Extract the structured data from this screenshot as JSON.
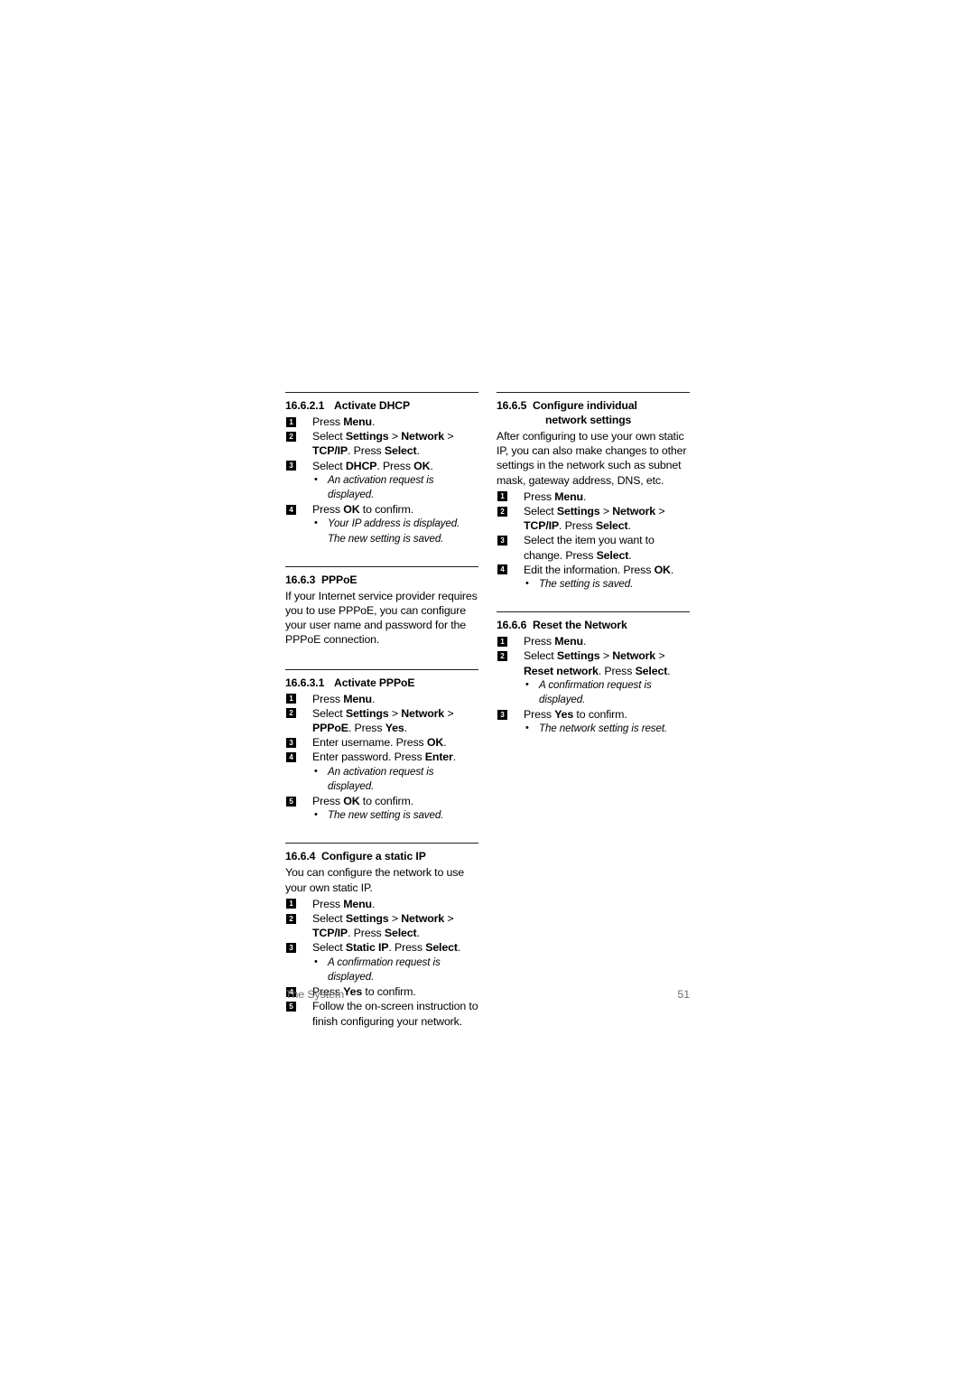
{
  "page": {
    "footer_left": "The System",
    "footer_page_number": "51",
    "footer_color": "#6d6e71",
    "rule_color": "#231f20",
    "background": "#ffffff"
  },
  "left_column": {
    "section_16_6_2_1": {
      "number": "16.6.2.1",
      "title": "Activate DHCP",
      "steps": [
        {
          "badge": "1",
          "text_html": "Press <b>Menu</b>."
        },
        {
          "badge": "2",
          "text_html": "Select <b>Settings</b> &gt; <b>Network</b> &gt; <b>TCP/IP</b>. Press <b>Select</b>."
        },
        {
          "badge": "3",
          "text_html": "Select <b>DHCP</b>. Press <b>OK</b>."
        }
      ],
      "note_after_step3": "An activation request is displayed.",
      "step4": {
        "badge": "4",
        "text_html": "Press <b>OK</b> to confirm."
      },
      "note_after_step4": "Your IP address is displayed. The new setting is saved."
    },
    "section_16_6_3": {
      "number": "16.6.3",
      "title": "PPPoE",
      "body": "If your Internet service provider requires you to use PPPoE, you can configure your user name and password for the PPPoE connection."
    },
    "section_16_6_3_1": {
      "number": "16.6.3.1",
      "title": "Activate PPPoE",
      "steps": [
        {
          "badge": "1",
          "text_html": "Press <b>Menu</b>."
        },
        {
          "badge": "2",
          "text_html": "Select <b>Settings</b> &gt; <b>Network</b> &gt; <b>PPPoE</b>. Press <b>Yes</b>."
        },
        {
          "badge": "3",
          "text_html": "Enter username. Press <b>OK</b>."
        },
        {
          "badge": "4",
          "text_html": "Enter password. Press <b>Enter</b>."
        }
      ],
      "note_after_step4": "An activation request is displayed.",
      "step5": {
        "badge": "5",
        "text_html": "Press <b>OK</b> to confirm."
      },
      "note_after_step5": "The new setting is saved."
    },
    "section_16_6_4": {
      "number": "16.6.4",
      "title": "Configure a static IP",
      "body": "You can configure the network to use your own static IP.",
      "steps": [
        {
          "badge": "1",
          "text_html": "Press <b>Menu</b>."
        },
        {
          "badge": "2",
          "text_html": "Select <b>Settings</b> &gt; <b>Network</b> &gt; <b>TCP/IP</b>. Press <b>Select</b>."
        },
        {
          "badge": "3",
          "text_html": "Select <b>Static IP</b>. Press <b>Select</b>."
        }
      ],
      "note_after_step3": "A confirmation request is displayed.",
      "step4": {
        "badge": "4",
        "text_html": "Press <b>Yes</b> to confirm."
      },
      "step5": {
        "badge": "5",
        "text_html": "Follow the on-screen instruction to finish configuring your network."
      }
    }
  },
  "right_column": {
    "section_16_6_5": {
      "number": "16.6.5",
      "title_line1": "Configure individual",
      "title_line2": "network settings",
      "body": "After configuring to use your own static IP, you can also make changes to other settings in the network such as subnet mask, gateway address, DNS, etc.",
      "steps": [
        {
          "badge": "1",
          "text_html": "Press <b>Menu</b>."
        },
        {
          "badge": "2",
          "text_html": "Select <b>Settings</b> &gt; <b>Network</b> &gt; <b>TCP/IP</b>. Press <b>Select</b>."
        },
        {
          "badge": "3",
          "text_html": "Select the item you want to change. Press <b>Select</b>."
        },
        {
          "badge": "4",
          "text_html": "Edit the information. Press <b>OK</b>."
        }
      ],
      "note_after_step4": "The setting is saved."
    },
    "section_16_6_6": {
      "number": "16.6.6",
      "title": "Reset the Network",
      "steps": [
        {
          "badge": "1",
          "text_html": "Press <b>Menu</b>."
        },
        {
          "badge": "2",
          "text_html": "Select <b>Settings</b> &gt; <b>Network</b> &gt; <b>Reset network</b>. Press <b>Select</b>."
        }
      ],
      "note_after_step2": "A confirmation request is displayed.",
      "step3": {
        "badge": "3",
        "text_html": "Press <b>Yes</b> to confirm."
      },
      "note_after_step3": "The network setting is reset."
    }
  }
}
